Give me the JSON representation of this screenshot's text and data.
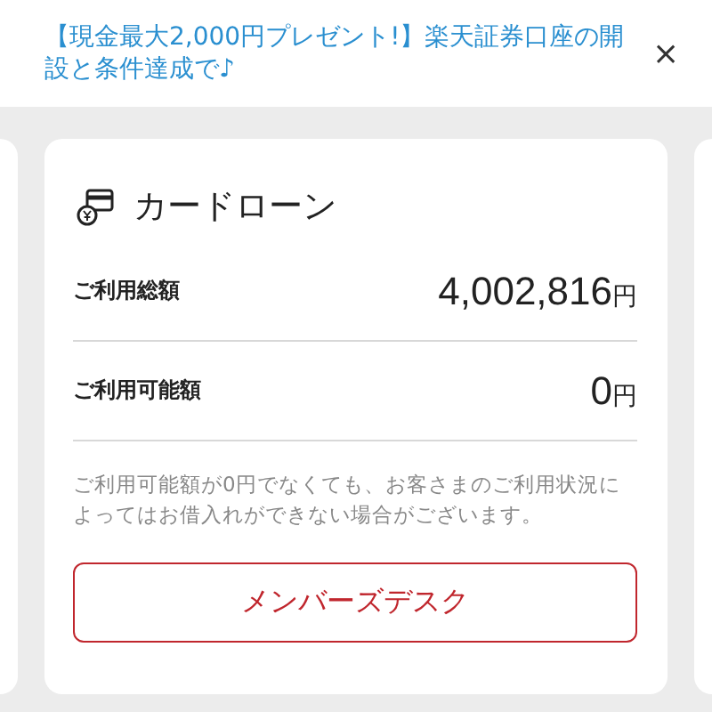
{
  "banner": {
    "text": "【現金最大2,000円プレゼント!】楽天証券口座の開設と条件達成で♪",
    "close": "×"
  },
  "card": {
    "title": "カードローン",
    "rows": [
      {
        "label": "ご利用総額",
        "amount": "4,002,816",
        "unit": "円"
      },
      {
        "label": "ご利用可能額",
        "amount": "0",
        "unit": "円"
      }
    ],
    "note": "ご利用可能額が0円でなくても、お客さまのご利用状況によってはお借入れができない場合がございます。",
    "button": "メンバーズデスク"
  }
}
